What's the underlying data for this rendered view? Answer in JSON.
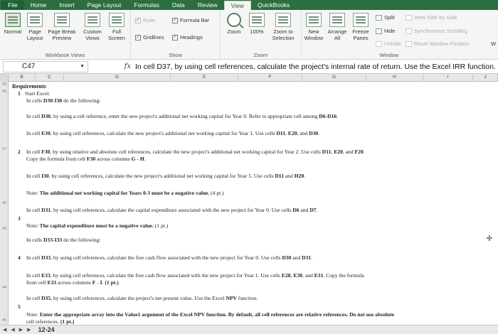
{
  "ribbon": {
    "tabs": [
      "File",
      "Home",
      "Insert",
      "Page Layout",
      "Formulas",
      "Data",
      "Review",
      "View",
      "QuickBooks"
    ],
    "active_tab": "View",
    "workbook_views": {
      "label": "Workbook Views",
      "normal": "Normal",
      "page_layout": "Page\nLayout",
      "page_break_preview": "Page Break\nPreview",
      "custom_views": "Custom\nViews",
      "full_screen": "Full\nScreen"
    },
    "show": {
      "label": "Show",
      "ruler": "Ruler",
      "formula_bar": "Formula Bar",
      "gridlines": "Gridlines",
      "headings": "Headings"
    },
    "zoom": {
      "label": "Zoom",
      "zoom": "Zoom",
      "zoom_100": "100%",
      "zoom_to_selection": "Zoom to\nSelection"
    },
    "window": {
      "label": "Window",
      "new_window": "New\nWindow",
      "arrange_all": "Arrange\nAll",
      "freeze_panes": "Freeze\nPanes",
      "split": "Split",
      "hide": "Hide",
      "unhide": "Unhide",
      "view_side_by_side": "View Side by Side",
      "synchronous_scrolling": "Synchronous Scrolling",
      "reset_window_position": "Reset Window Position",
      "switch_windows_initial": "W"
    }
  },
  "formula_bar": {
    "name_box": "C47",
    "fx": "fx",
    "formula": "In cell D37, by using cell references, calculate the project's internal rate of return. Use the Excel IRR function."
  },
  "columns": [
    "B",
    "C",
    "D",
    "E",
    "F",
    "G",
    "H",
    "I",
    "J"
  ],
  "row_numbers": [
    "25",
    "26",
    "27",
    "42",
    "43",
    "44",
    "45"
  ],
  "sheet": {
    "heading": "Requirements",
    "items": [
      {
        "num": "1",
        "text": "Start Excel."
      },
      {
        "text_parts": [
          "In cells ",
          "D30",
          "-",
          "I30",
          " do the following:"
        ]
      },
      {
        "text_parts": [
          "In cell ",
          "D30",
          ", by using a cell reference, enter the new project's additional net working capital for Year 0. Refer to appropriate cell among ",
          "D6-D16",
          "."
        ]
      },
      {
        "text_parts": [
          "In cell ",
          "E30",
          ", by using cell references, calculate the new project's additional net working capital for Year 1. Use cells ",
          "D11",
          ", ",
          "E20",
          ", and ",
          "D30",
          "."
        ]
      },
      {
        "num": "2",
        "text_parts": [
          "In cell ",
          "F30",
          ", by using relative and absolute cell references, calculate the new project's additional net working capital for Year 2. Use cells ",
          "D11",
          ", ",
          "E20",
          ", and ",
          "F20",
          "."
        ]
      },
      {
        "text_parts": [
          "Copy the formula from cell ",
          "F30",
          " across columns ",
          "G",
          " - ",
          "H",
          "."
        ]
      },
      {
        "text_parts": [
          "In cell ",
          "I30",
          ", by using cell references, calculate the new project's additional net working capital for Year 5. Use cells ",
          "D11",
          " and ",
          "H20",
          "."
        ]
      },
      {
        "text_parts": [
          "Note:",
          " The additional net working capital for Years 0-3 must be a negative value. ",
          "(4 pt.)"
        ]
      },
      {
        "text_parts": [
          "In cell ",
          "D31",
          ", by using cell references, calculate the capital expenditure associated with the new project for Year 0. Use cells ",
          "D6",
          " and ",
          "D7",
          "."
        ]
      },
      {
        "num": "3",
        "text_parts": [
          "Note:",
          " The capital expenditure must be a negative value. ",
          "(1 pt.)"
        ]
      },
      {
        "text_parts": [
          "In cells ",
          "D33",
          "-",
          "I33",
          " do the following:"
        ]
      },
      {
        "num": "4",
        "text_parts": [
          "In cell ",
          "D33",
          ", by using cell references, calculate the free cash flow associated with the new project for Year 0. Use cells ",
          "D30",
          " and ",
          "D31",
          "."
        ]
      },
      {
        "text_parts": [
          "In cell ",
          "E33",
          ", by using cell references, calculate the free cash flow associated with the new project for Year 1. Use cells ",
          "E28",
          ", ",
          "E30",
          ", and ",
          "E31",
          ". Copy the formula"
        ]
      },
      {
        "text_parts": [
          "from cell ",
          "E33",
          " across columns ",
          "F",
          " - ",
          "I",
          ". ",
          "(1 pt.)"
        ]
      },
      {
        "text_parts": [
          "In cell ",
          "D35",
          ", by using cell references, calculate the project's net present value. Use the Excel ",
          "NPV",
          " function."
        ]
      },
      {
        "num": "5",
        "text_parts": [
          "Note:",
          " Enter the appropriate array into the Value1 argument of the Excel NPV function. By default, all cell references are relative references. Do not use absolute"
        ]
      },
      {
        "text_parts": [
          "cell references. ",
          "(1 pt.)"
        ]
      }
    ]
  },
  "sheet_tab": "12-24",
  "colors": {
    "ribbon_green": "#2c6e3f",
    "ribbon_bg": "#f4f6f4"
  }
}
